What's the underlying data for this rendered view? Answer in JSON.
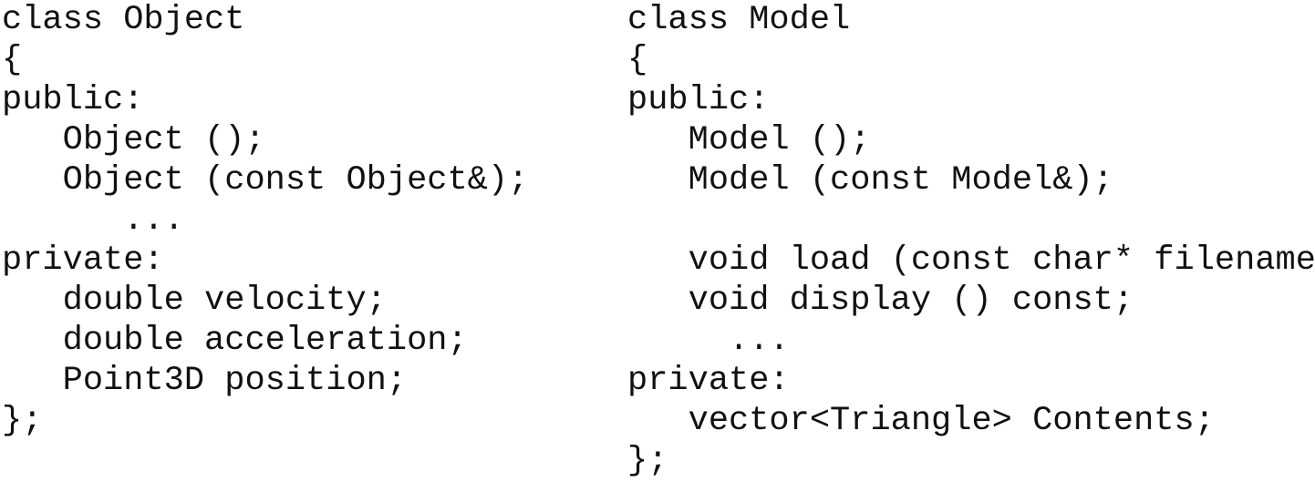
{
  "left_code": {
    "lines": [
      "class Object",
      "{",
      "public:",
      "   Object ();",
      "   Object (const Object&);",
      "      ...",
      "private:",
      "   double velocity;",
      "   double acceleration;",
      "   Point3D position;",
      "};"
    ]
  },
  "right_code": {
    "lines": [
      "class Model",
      "{",
      "public:",
      "   Model ();",
      "   Model (const Model&);",
      "",
      "   void load (const char* filename);",
      "   void display () const;",
      "     ...",
      "private:",
      "   vector<Triangle> Contents;",
      "};"
    ]
  }
}
